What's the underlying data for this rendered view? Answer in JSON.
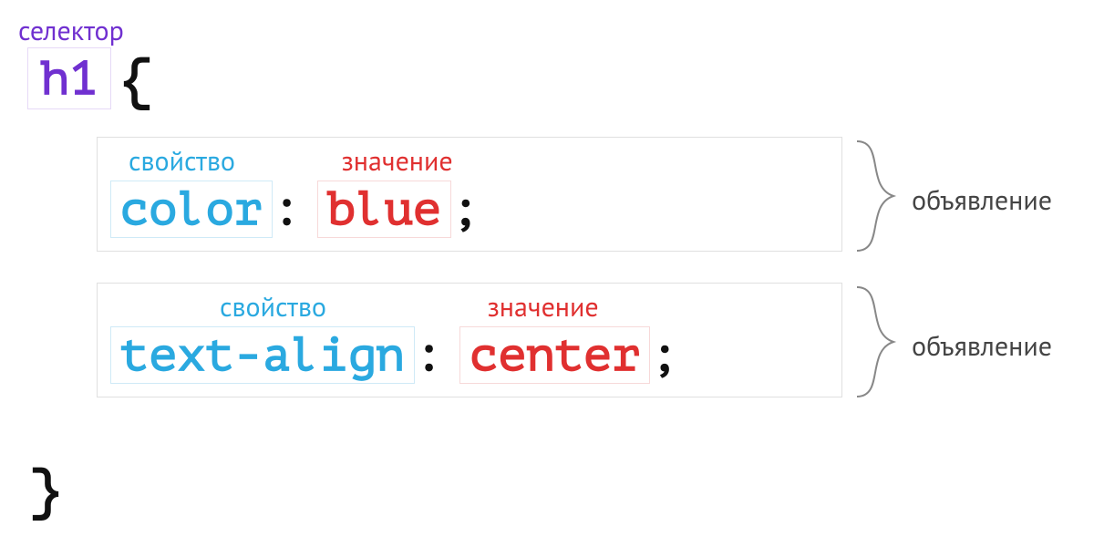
{
  "labels": {
    "selector": "селектор",
    "property": "свойство",
    "value": "значение",
    "declaration": "объявление"
  },
  "css": {
    "selector": "h1",
    "open_brace": "{",
    "close_brace": "}",
    "colon": ":",
    "semicolon": ";",
    "declarations": [
      {
        "property": "color",
        "value": "blue"
      },
      {
        "property": "text-align",
        "value": "center"
      }
    ]
  }
}
